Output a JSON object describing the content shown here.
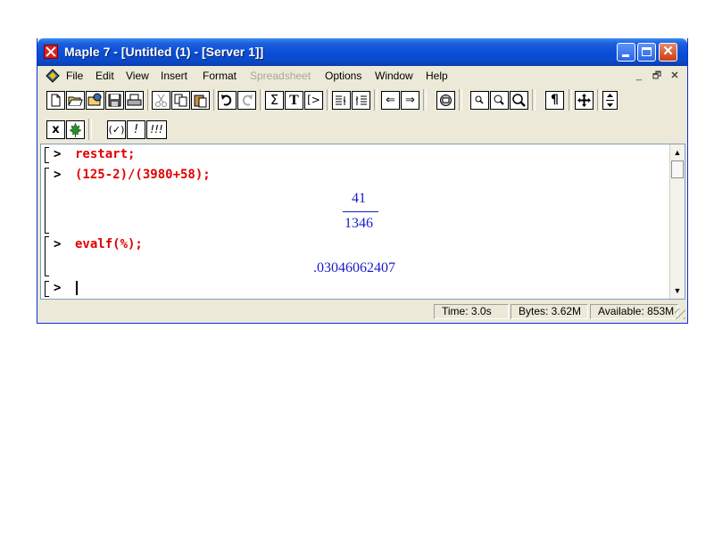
{
  "window": {
    "title": "Maple 7  - [Untitled (1) - [Server 1]]",
    "controls": {
      "minimize": "_",
      "maximize": "□",
      "close": "✕"
    }
  },
  "menubar": {
    "items": [
      {
        "label": "File"
      },
      {
        "label": "Edit"
      },
      {
        "label": "View"
      },
      {
        "label": "Insert"
      },
      {
        "label": "Format"
      },
      {
        "label": "Spreadsheet",
        "disabled": true
      },
      {
        "label": "Options"
      },
      {
        "label": "Window"
      },
      {
        "label": "Help"
      }
    ],
    "mdi_controls": [
      "_",
      "🗗",
      "✕"
    ]
  },
  "toolbar": {
    "icons": [
      "new-file-icon",
      "open-file-icon",
      "open-url-icon",
      "save-icon",
      "print-icon",
      "cut-icon",
      "copy-icon",
      "paste-icon",
      "undo-icon",
      "redo-icon",
      "sum-icon",
      "text-icon",
      "insert-prompt-icon",
      "indent-icon",
      "outdent-icon",
      "back-icon",
      "forward-icon",
      "stop-icon",
      "zoom-100-icon",
      "zoom-200-icon",
      "zoom-400-icon",
      "paragraph-icon",
      "restart-icon",
      "toggle-icon"
    ],
    "glyphs": {
      "sum": "Σ",
      "text": "T",
      "prompt": "[>",
      "back": "⇐",
      "forward": "⇒",
      "paragraph": "¶",
      "zoom1": "🔍︎",
      "zoom2": "🔍︎",
      "zoom3": "🔍︎"
    }
  },
  "toolbar2": {
    "x": "x",
    "check": "(✓)",
    "bang": "!",
    "bang3": "!!!"
  },
  "worksheet": {
    "prompt": ">",
    "lines": [
      {
        "input": "restart;"
      },
      {
        "input": "(125-2)/(3980+58);",
        "output": {
          "numerator": "41",
          "denominator": "1346"
        }
      },
      {
        "input": "evalf(%);",
        "output": {
          "value": ".03046062407"
        }
      },
      {
        "input": ""
      }
    ]
  },
  "statusbar": {
    "time": "Time:   3.0s",
    "bytes": "Bytes: 3.62M",
    "available": "Available: 853M"
  }
}
